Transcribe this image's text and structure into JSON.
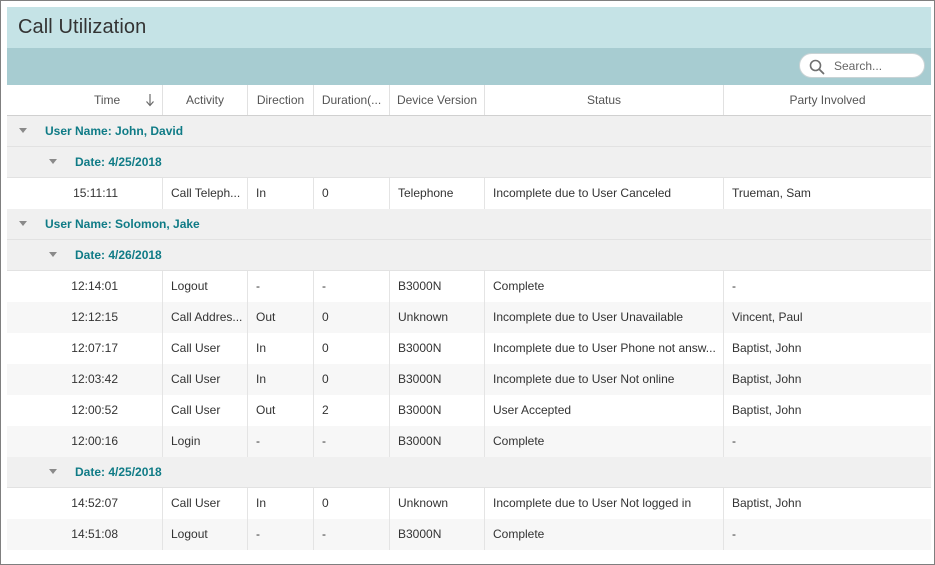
{
  "title": "Call Utilization",
  "search": {
    "placeholder": "Search..."
  },
  "columns": [
    "Time",
    "Activity",
    "Direction",
    "Duration(...",
    "Device Version",
    "Status",
    "Party Involved"
  ],
  "groups": [
    {
      "user_label": "User Name: John, David",
      "dates": [
        {
          "date_label": "Date: 4/25/2018",
          "rows": [
            [
              "15:11:11",
              "Call Teleph...",
              "In",
              "0",
              "Telephone",
              "Incomplete due to User Canceled",
              "Trueman, Sam"
            ]
          ]
        }
      ]
    },
    {
      "user_label": "User Name: Solomon, Jake",
      "dates": [
        {
          "date_label": "Date: 4/26/2018",
          "rows": [
            [
              "12:14:01",
              "Logout",
              "-",
              "-",
              "B3000N",
              "Complete",
              "-"
            ],
            [
              "12:12:15",
              "Call Addres...",
              "Out",
              "0",
              "Unknown",
              "Incomplete due to User Unavailable",
              "Vincent, Paul"
            ],
            [
              "12:07:17",
              "Call User",
              "In",
              "0",
              "B3000N",
              "Incomplete due to User Phone not answ...",
              "Baptist, John"
            ],
            [
              "12:03:42",
              "Call User",
              "In",
              "0",
              "B3000N",
              "Incomplete due to User Not online",
              "Baptist, John"
            ],
            [
              "12:00:52",
              "Call User",
              "Out",
              "2",
              "B3000N",
              "User Accepted",
              "Baptist, John"
            ],
            [
              "12:00:16",
              "Login",
              "-",
              "-",
              "B3000N",
              "Complete",
              "-"
            ]
          ]
        },
        {
          "date_label": "Date: 4/25/2018",
          "rows": [
            [
              "14:52:07",
              "Call User",
              "In",
              "0",
              "Unknown",
              "Incomplete due to User Not logged in",
              "Baptist, John"
            ],
            [
              "14:51:08",
              "Logout",
              "-",
              "-",
              "B3000N",
              "Complete",
              "-"
            ]
          ]
        }
      ]
    }
  ]
}
